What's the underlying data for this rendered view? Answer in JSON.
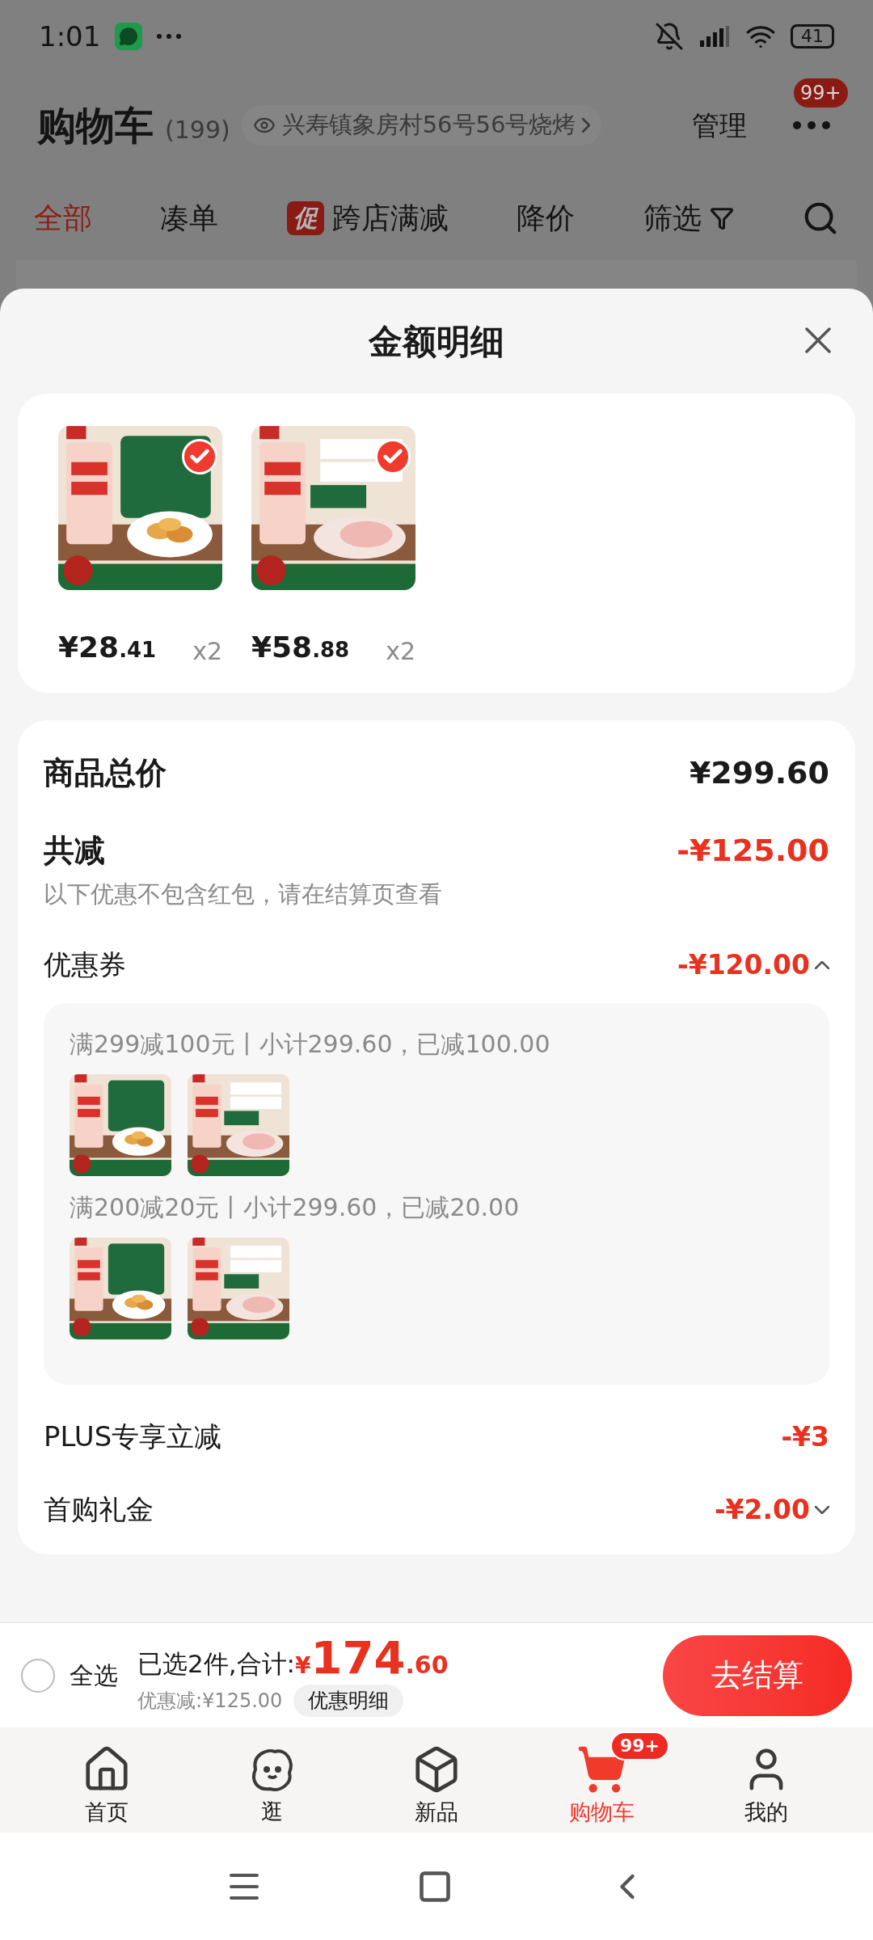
{
  "status_bar": {
    "time": "1:01",
    "battery": "41"
  },
  "header": {
    "title": "购物车",
    "count": "(199)",
    "address": "兴寿镇象房村56号56号烧烤",
    "manage": "管理",
    "badge": "99+"
  },
  "filter_tabs": [
    {
      "label": "全部",
      "selected": true
    },
    {
      "label": "凑单",
      "selected": false
    },
    {
      "label": "跨店满减",
      "selected": false,
      "badge": "促"
    },
    {
      "label": "降价",
      "selected": false
    },
    {
      "label": "筛选",
      "selected": false
    }
  ],
  "sheet": {
    "title": "金额明细",
    "products": [
      {
        "price_main": "¥28",
        "price_cents": ".41",
        "quantity": "x2",
        "checked": true
      },
      {
        "price_main": "¥58",
        "price_cents": ".88",
        "quantity": "x2",
        "checked": true
      }
    ],
    "total": {
      "label": "商品总价",
      "value": "¥299.60"
    },
    "reduction": {
      "label": "共减",
      "value": "-¥125.00",
      "note": "以下优惠不包含红包，请在结算页查看"
    },
    "coupons": {
      "label": "优惠券",
      "value": "-¥120.00",
      "expanded": true,
      "groups": [
        {
          "text": "满299减100元丨小计299.60，已减100.00"
        },
        {
          "text": "满200减20元丨小计299.60，已减20.00"
        }
      ]
    },
    "other_discounts": [
      {
        "label": "PLUS专享立减",
        "value": "-¥3",
        "kind": "plain"
      },
      {
        "label": "首购礼金",
        "value": "-¥2.00",
        "kind": "dropdown"
      }
    ]
  },
  "checkout_bar": {
    "select_all": {
      "label": "全选",
      "checked": false
    },
    "summary": "已选2件,合计:",
    "currency": "¥",
    "amount_main": "174",
    "amount_cents": ".60",
    "discount": "优惠减:¥125.00",
    "detail_button": "优惠明细",
    "checkout_button": "去结算"
  },
  "tab_bar": [
    {
      "label": "首页",
      "selected": false
    },
    {
      "label": "逛",
      "selected": false
    },
    {
      "label": "新品",
      "selected": false
    },
    {
      "label": "购物车",
      "selected": true,
      "badge": "99+"
    },
    {
      "label": "我的",
      "selected": false
    }
  ]
}
